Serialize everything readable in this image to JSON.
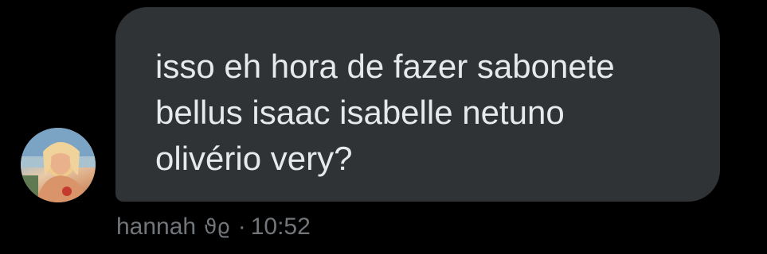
{
  "message": {
    "text": "isso eh hora de fazer sabonete\nbellus isaac isabelle netuno\nolivério very?",
    "sender_name": "hannah",
    "sender_glyphs": "ϑϱ",
    "separator": "·",
    "time": "10:52"
  },
  "colors": {
    "background": "#000000",
    "bubble": "#2f3336",
    "text": "#e7e9ea",
    "meta": "#71767b"
  },
  "icons": {
    "avatar": "user-avatar-photo"
  }
}
